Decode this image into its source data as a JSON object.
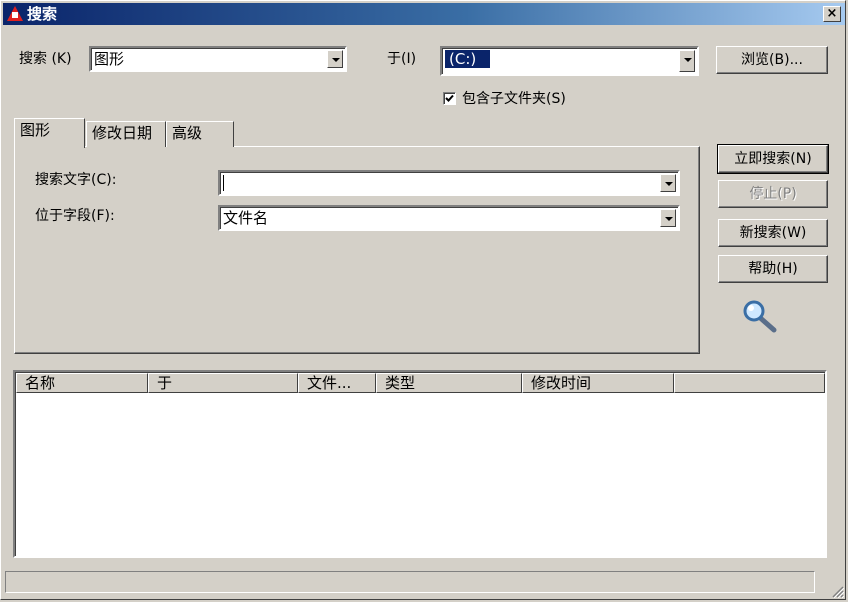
{
  "window": {
    "title": "搜索",
    "close_label": "×"
  },
  "search_row": {
    "search_label": "搜索 (K)",
    "search_value": "图形",
    "in_label": "于(I)",
    "in_value": "(C:)",
    "browse_label": "浏览(B)..."
  },
  "include_subfolders": {
    "label": "包含子文件夹(S)",
    "checked": true
  },
  "tabs": [
    {
      "label": "图形",
      "active": true
    },
    {
      "label": "修改日期",
      "active": false
    },
    {
      "label": "高级",
      "active": false
    }
  ],
  "drawing_tab": {
    "search_text_label": "搜索文字(C):",
    "search_text_value": "",
    "field_label": "位于字段(F):",
    "field_value": "文件名"
  },
  "buttons": {
    "search_now": "立即搜索(N)",
    "stop": "停止(P)",
    "new_search": "新搜索(W)",
    "help": "帮助(H)"
  },
  "results": {
    "columns": [
      "名称",
      "于",
      "文件...",
      "类型",
      "修改时间",
      ""
    ]
  },
  "icons": {
    "magnifier": "magnifier-icon",
    "size_grip": "size-grip-icon",
    "app": "autocad-icon"
  }
}
